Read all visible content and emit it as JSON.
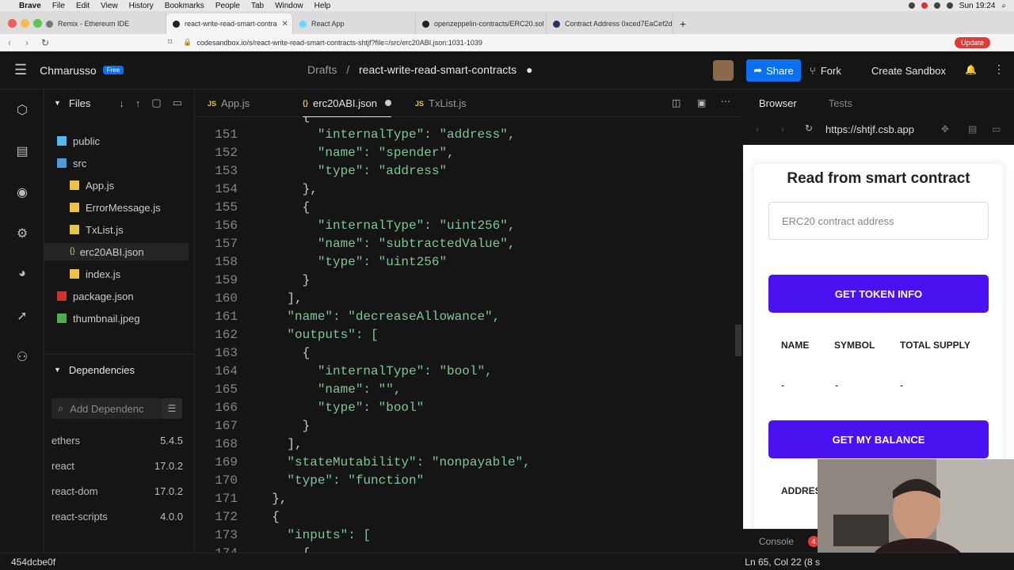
{
  "menubar": {
    "app": "Brave",
    "items": [
      "File",
      "Edit",
      "View",
      "History",
      "Bookmarks",
      "People",
      "Tab",
      "Window",
      "Help"
    ],
    "clock": "Sun 19:24"
  },
  "browser": {
    "tabs": [
      {
        "label": "Remix - Ethereum IDE",
        "active": false
      },
      {
        "label": "react-write-read-smart-contra",
        "active": true
      },
      {
        "label": "React App",
        "active": false
      },
      {
        "label": "openzeppelin-contracts/ERC20.sol",
        "active": false
      },
      {
        "label": "Contract Address 0xced7EaCef2db",
        "active": false
      }
    ],
    "url": "codesandbox.io/s/react-write-read-smart-contracts-shtjf?file=/src/erc20ABI.json:1031-1039",
    "update_label": "Update"
  },
  "header": {
    "username": "Chmarusso",
    "plan_badge": "Free",
    "breadcrumb_root": "Drafts",
    "breadcrumb_sep": "/",
    "project_name": "react-write-read-smart-contracts",
    "share_label": "Share",
    "fork_label": "Fork",
    "create_label": "Create Sandbox"
  },
  "explorer": {
    "files_title": "Files",
    "tree": [
      {
        "name": "public",
        "type": "folder",
        "depth": 0
      },
      {
        "name": "src",
        "type": "folder",
        "depth": 0
      },
      {
        "name": "App.js",
        "type": "js",
        "depth": 1
      },
      {
        "name": "ErrorMessage.js",
        "type": "js",
        "depth": 1
      },
      {
        "name": "TxList.js",
        "type": "js",
        "depth": 1
      },
      {
        "name": "erc20ABI.json",
        "type": "json",
        "depth": 1,
        "selected": true
      },
      {
        "name": "index.js",
        "type": "js",
        "depth": 1
      },
      {
        "name": "package.json",
        "type": "pkg",
        "depth": 0
      },
      {
        "name": "thumbnail.jpeg",
        "type": "img",
        "depth": 0
      }
    ],
    "deps_title": "Dependencies",
    "deps_search_placeholder": "Add Dependenc",
    "deps": [
      {
        "name": "ethers",
        "version": "5.4.5"
      },
      {
        "name": "react",
        "version": "17.0.2"
      },
      {
        "name": "react-dom",
        "version": "17.0.2"
      },
      {
        "name": "react-scripts",
        "version": "4.0.0"
      }
    ]
  },
  "editor": {
    "tabs": [
      {
        "label": "App.js",
        "icon": "JS",
        "active": false
      },
      {
        "label": "erc20ABI.json",
        "icon": "{}",
        "active": true,
        "modified": true
      },
      {
        "label": "TxList.js",
        "icon": "JS",
        "active": false
      }
    ],
    "lines": [
      {
        "n": "",
        "t": "      {"
      },
      {
        "n": "151",
        "t": "        \"internalType\": \"address\","
      },
      {
        "n": "152",
        "t": "        \"name\": \"spender\","
      },
      {
        "n": "153",
        "t": "        \"type\": \"address\""
      },
      {
        "n": "154",
        "t": "      },"
      },
      {
        "n": "155",
        "t": "      {"
      },
      {
        "n": "156",
        "t": "        \"internalType\": \"uint256\","
      },
      {
        "n": "157",
        "t": "        \"name\": \"subtractedValue\","
      },
      {
        "n": "158",
        "t": "        \"type\": \"uint256\""
      },
      {
        "n": "159",
        "t": "      }"
      },
      {
        "n": "160",
        "t": "    ],"
      },
      {
        "n": "161",
        "t": "    \"name\": \"decreaseAllowance\","
      },
      {
        "n": "162",
        "t": "    \"outputs\": ["
      },
      {
        "n": "163",
        "t": "      {"
      },
      {
        "n": "164",
        "t": "        \"internalType\": \"bool\","
      },
      {
        "n": "165",
        "t": "        \"name\": \"\","
      },
      {
        "n": "166",
        "t": "        \"type\": \"bool\""
      },
      {
        "n": "167",
        "t": "      }"
      },
      {
        "n": "168",
        "t": "    ],"
      },
      {
        "n": "169",
        "t": "    \"stateMutability\": \"nonpayable\","
      },
      {
        "n": "170",
        "t": "    \"type\": \"function\""
      },
      {
        "n": "171",
        "t": "  },"
      },
      {
        "n": "172",
        "t": "  {"
      },
      {
        "n": "173",
        "t": "    \"inputs\": ["
      },
      {
        "n": "174",
        "t": "      {"
      }
    ]
  },
  "preview": {
    "tab_browser": "Browser",
    "tab_tests": "Tests",
    "url": "https://shtjf.csb.app",
    "title": "Read from smart contract",
    "address_placeholder": "ERC20 contract address",
    "get_token_info_label": "GET TOKEN INFO",
    "table_headers": [
      "NAME",
      "SYMBOL",
      "TOTAL SUPPLY"
    ],
    "table_values": [
      "-",
      "-",
      "-"
    ],
    "get_balance_label": "GET MY BALANCE",
    "address_label": "ADDRES",
    "console_label": "Console",
    "console_count": "4"
  },
  "status": {
    "hash": "454dcbe0f",
    "cursor": "Ln 65, Col 22 (8 s"
  },
  "colors": {
    "accent_blue": "#0971f1",
    "button_purple": "#4a12f0",
    "editor_bg": "#151515",
    "code_string": "#7ec699"
  }
}
